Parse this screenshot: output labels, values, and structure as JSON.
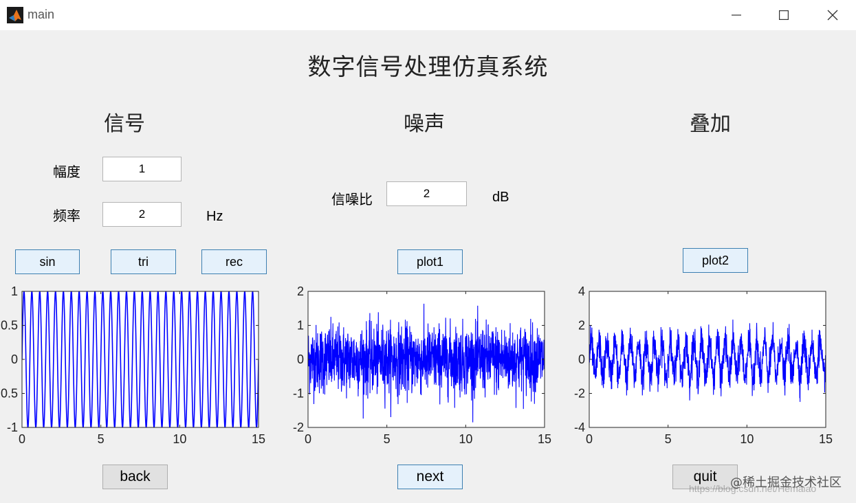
{
  "window": {
    "title": "main"
  },
  "page_title": "数字信号处理仿真系统",
  "signal": {
    "heading": "信号",
    "amplitude_label": "幅度",
    "amplitude_value": "1",
    "frequency_label": "频率",
    "frequency_value": "2",
    "frequency_unit": "Hz",
    "buttons": {
      "sin": "sin",
      "tri": "tri",
      "rec": "rec"
    }
  },
  "noise": {
    "heading": "噪声",
    "snr_label": "信噪比",
    "snr_value": "2",
    "snr_unit": "dB",
    "plot_button": "plot1"
  },
  "overlay": {
    "heading": "叠加",
    "plot_button": "plot2"
  },
  "nav": {
    "back": "back",
    "next": "next",
    "quit": "quit"
  },
  "watermark": {
    "brand": "@稀土掘金技术社区",
    "url": "https://blog.csdn.net/Hemaiao"
  },
  "colors": {
    "plot_line": "#0000ff",
    "button_border": "#3c7fb1",
    "button_bg": "#e5f1fb"
  },
  "chart_data": [
    {
      "type": "line",
      "name_hint": "signal",
      "x_range": [
        0,
        15
      ],
      "xlim": [
        0,
        15
      ],
      "ylim": [
        -1,
        1
      ],
      "xticks": [
        "0",
        "5",
        "10",
        "15"
      ],
      "yticks": [
        "1",
        "0.5",
        "0",
        "0.5",
        "-1"
      ],
      "signal": {
        "kind": "sine",
        "amplitude": 1,
        "frequency": 2
      }
    },
    {
      "type": "line",
      "name_hint": "noise",
      "x_range": [
        0,
        15
      ],
      "xlim": [
        0,
        15
      ],
      "ylim": [
        -2,
        2
      ],
      "xticks": [
        "0",
        "5",
        "10",
        "15"
      ],
      "yticks": [
        "2",
        "1",
        "0",
        "-1",
        "-2"
      ],
      "signal": {
        "kind": "noise",
        "std": 0.5
      }
    },
    {
      "type": "line",
      "name_hint": "overlay",
      "x_range": [
        0,
        15
      ],
      "xlim": [
        0,
        15
      ],
      "ylim": [
        -4,
        4
      ],
      "xticks": [
        "0",
        "5",
        "10",
        "15"
      ],
      "yticks": [
        "4",
        "2",
        "0",
        "-2",
        "-4"
      ],
      "signal": {
        "kind": "sine+noise",
        "amplitude": 1,
        "frequency": 2,
        "std": 0.5
      }
    }
  ]
}
